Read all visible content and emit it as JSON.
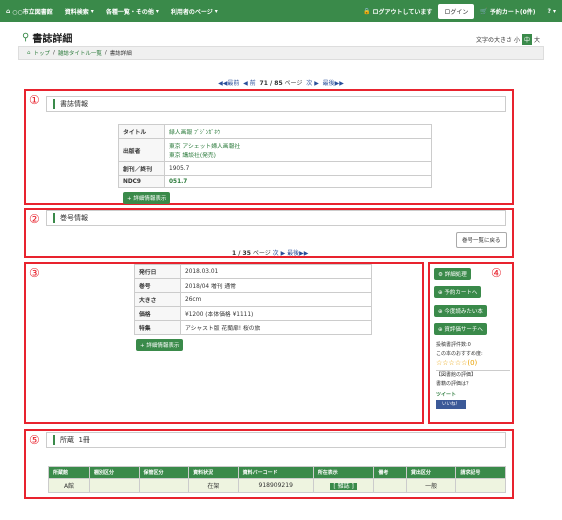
{
  "nav": {
    "logo": "○○市立図書館",
    "search": "資料検索",
    "lists": "各種一覧・その他",
    "user": "利用者のページ",
    "login_status": "ログアウトしています",
    "login": "ログイン",
    "cart": "予約カート(0件)"
  },
  "page_title": "書誌詳細",
  "font_size": {
    "label": "文字の大きさ",
    "small": "小",
    "medium": "中",
    "large": "大"
  },
  "breadcrumb": [
    "トップ",
    "雑誌タイトル一覧",
    "書誌詳細"
  ],
  "pager": {
    "first": "最前",
    "prev": "前",
    "current": "71 / 85",
    "page": "ページ",
    "next": "次",
    "last": "最後"
  },
  "numbers": [
    "①",
    "②",
    "③",
    "④",
    "⑤"
  ],
  "biblio": {
    "title": "書誌情報",
    "rows": [
      {
        "k": "タイトル",
        "v": "緑人画報 ﾌﾞｼﾞﾝｶﾞﾎｳ"
      },
      {
        "k": "出版者",
        "v": "東京 アシェット婦人画報社\n東京 講談社(発売)"
      },
      {
        "k": "創刊／終刊",
        "v": "1905.7"
      },
      {
        "k": "NDC9",
        "v": "051.7"
      }
    ],
    "more": "+ 詳細情報表示"
  },
  "vol": {
    "title": "巻号情報",
    "pager": "1 / 35",
    "page": "ページ",
    "next": "次",
    "last": "最後",
    "back": "巻号一覧に戻る"
  },
  "issue": {
    "rows": [
      {
        "k": "発行日",
        "v": "2018.03.01"
      },
      {
        "k": "巻号",
        "v": "2018/04 増刊 通常"
      },
      {
        "k": "大きさ",
        "v": "26cm"
      },
      {
        "k": "価格",
        "v": "¥1200 (本体価格 ¥1111)"
      },
      {
        "k": "特集",
        "v": "アシャスト版 花蘭扉! 桜の旅"
      }
    ],
    "more": "+ 詳細情報表示"
  },
  "side": {
    "btn1": "詳細処理",
    "btn2": "予約カートへ",
    "btn3": "今度読みたい本",
    "btn4": "資評価サーチへ",
    "reviews": "投稿書評件数:0",
    "recommend": "この本のおすすめ度:",
    "stars": "☆☆☆☆☆(0)",
    "lib_review": "【図書館の評価】",
    "question": "書籍の評価は？",
    "tweet": "ツイート",
    "like": "いいね！"
  },
  "holdings": {
    "title": "所蔵",
    "count": "1冊",
    "headers": [
      "所蔵館",
      "棚別区分",
      "保管区分",
      "資料状況",
      "資料バーコード",
      "所在表示",
      "備考",
      "貸出区分",
      "請求記号"
    ],
    "row": [
      "A館",
      "",
      "",
      "在架",
      "918909219",
      "[ 雑誌 ]",
      "",
      "一般",
      ""
    ]
  }
}
